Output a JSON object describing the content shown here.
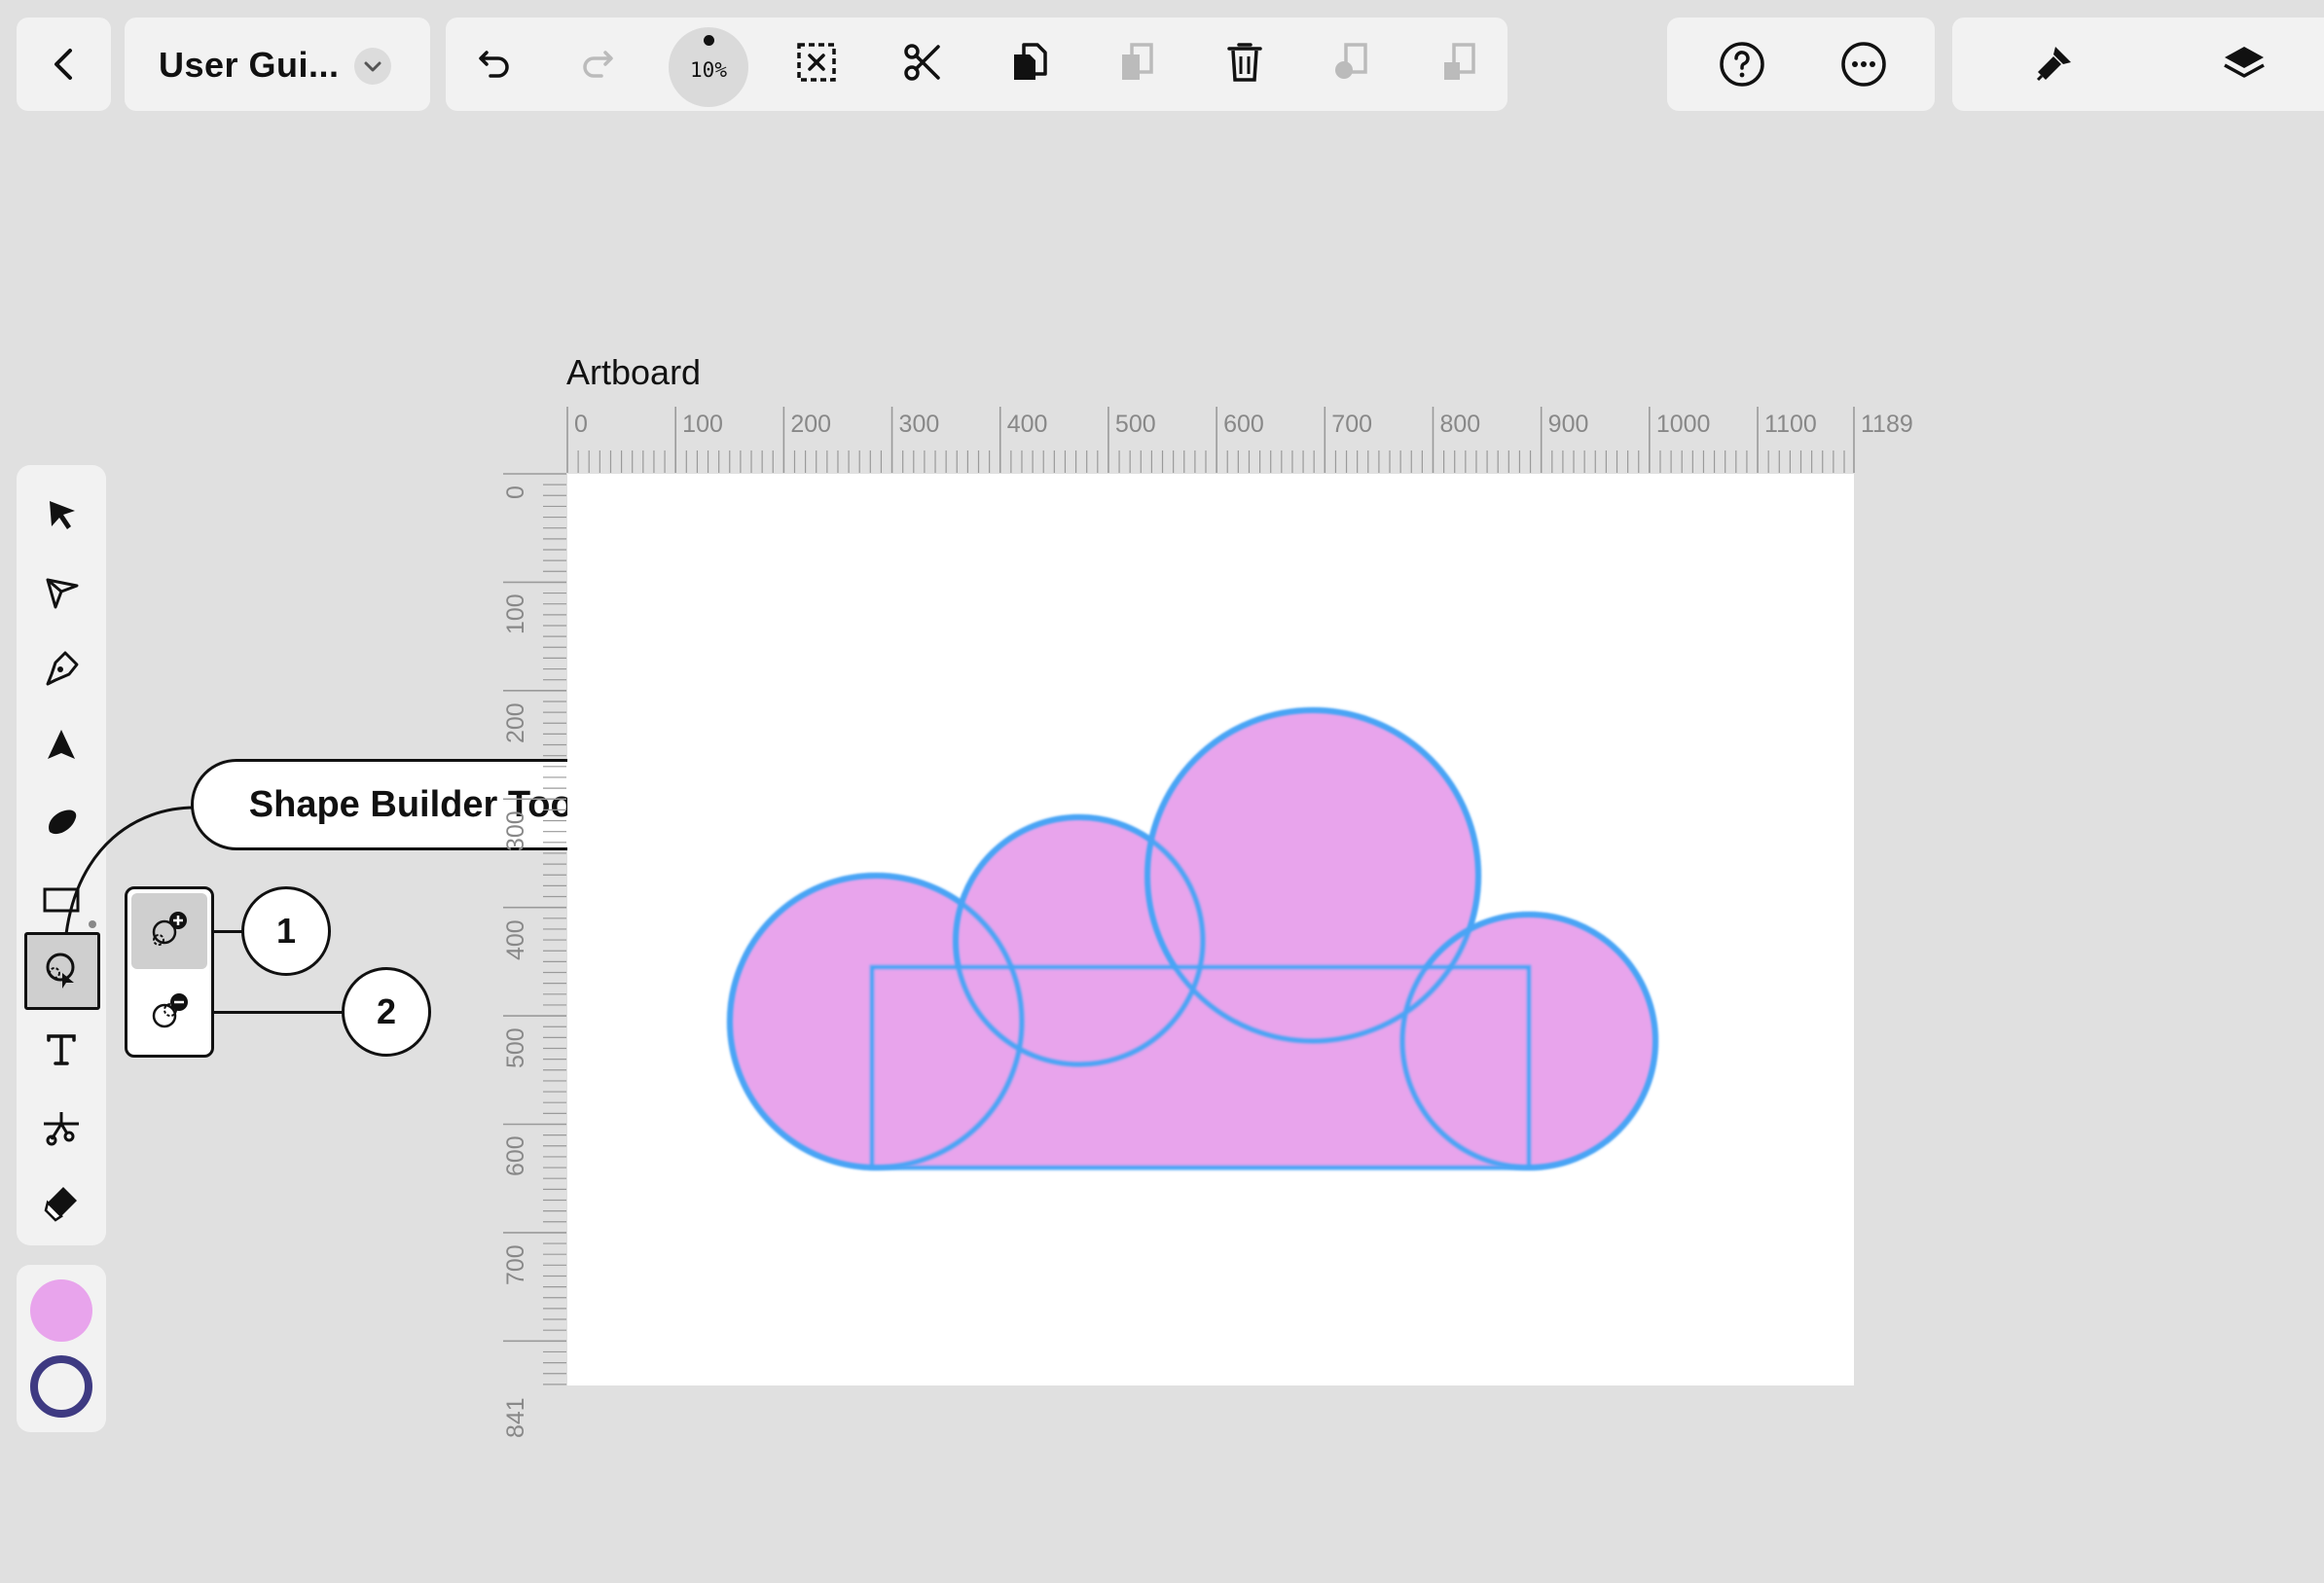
{
  "header": {
    "doc_title": "User Gui...",
    "zoom": "10%"
  },
  "artboard": {
    "label": "Artboard",
    "h_ruler_ticks": [
      "0",
      "100",
      "200",
      "300",
      "400",
      "500",
      "600",
      "700",
      "800",
      "900",
      "1000",
      "1100",
      "1189"
    ],
    "v_ruler_ticks": [
      "0",
      "100",
      "200",
      "300",
      "400",
      "500",
      "600",
      "700",
      "841"
    ]
  },
  "callouts": {
    "main": "Shape Builder Tool",
    "n1": "1",
    "n2": "2"
  },
  "colors": {
    "fill": "#e8a4ec",
    "stroke": "#3e3a82",
    "shape_stroke": "#4aa4f5",
    "canvas_bg": "#e0e0e0",
    "panel_bg": "#f2f2f2"
  },
  "icons": {
    "toolbar": [
      "back-icon",
      "chevron-down-icon",
      "undo-icon",
      "redo-icon",
      "zoom-icon",
      "deselect-icon",
      "cut-icon",
      "copy-icon",
      "paste-icon",
      "delete-icon",
      "duplicate-icon",
      "paste-in-place-icon",
      "help-icon",
      "more-icon",
      "brush-icon",
      "layers-icon"
    ],
    "tools": [
      "select-icon",
      "direct-select-icon",
      "pen-icon",
      "pencil-icon",
      "brush-tool-icon",
      "rectangle-icon",
      "shape-builder-icon",
      "text-icon",
      "scissors-tool-icon",
      "eraser-icon"
    ]
  }
}
